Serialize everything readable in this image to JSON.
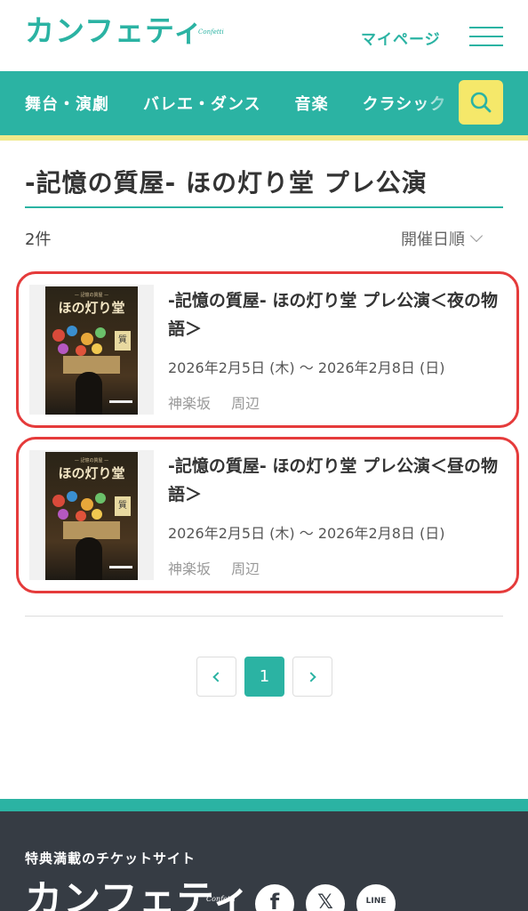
{
  "header": {
    "logo_text": "カンフェティ",
    "logo_sub": "Confetti",
    "mypage_label": "マイページ"
  },
  "categories": [
    "舞台・演劇",
    "バレエ・ダンス",
    "音楽",
    "クラシック"
  ],
  "page_title": "-記憶の質屋- ほの灯り堂 プレ公演",
  "result_count": "2件",
  "sort_label": "開催日順",
  "events": [
    {
      "title": "-記憶の質屋- ほの灯り堂 プレ公演＜夜の物語＞",
      "date": "2026年2月5日 (木) 〜 2026年2月8日 (日)",
      "venue": "神楽坂",
      "area": "周辺",
      "poster": {
        "small_text": "— 記憶の質屋 —",
        "title": "ほの灯り堂",
        "badge": "質"
      }
    },
    {
      "title": "-記憶の質屋- ほの灯り堂 プレ公演＜昼の物語＞",
      "date": "2026年2月5日 (木) 〜 2026年2月8日 (日)",
      "venue": "神楽坂",
      "area": "周辺",
      "poster": {
        "small_text": "— 記憶の質屋 —",
        "title": "ほの灯り堂",
        "badge": "質"
      }
    }
  ],
  "pagination": {
    "current": "1"
  },
  "footer": {
    "tagline": "特典満載のチケットサイト",
    "logo_text": "カンフェティ",
    "logo_sub": "Confetti",
    "social": {
      "facebook": "f",
      "x": "𝕏",
      "line": "LINE"
    }
  },
  "colors": {
    "brand": "#2bb3a3",
    "search_bg": "#f5e86a",
    "highlight": "#e53b3b",
    "footer_bg": "#363c44"
  }
}
